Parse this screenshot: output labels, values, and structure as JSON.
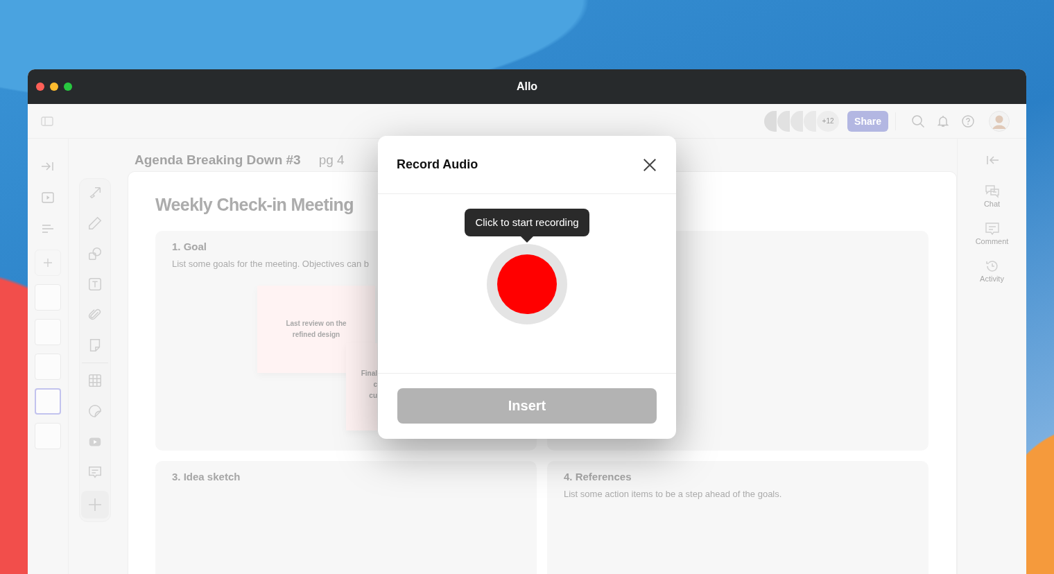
{
  "window": {
    "title": "Allo"
  },
  "toolbar": {
    "more_collaborators": "+12",
    "share_button": "Share"
  },
  "page_thumbnails": [
    {
      "selected": false
    },
    {
      "selected": false
    },
    {
      "selected": false
    },
    {
      "selected": true
    },
    {
      "selected": false
    }
  ],
  "document": {
    "name": "Agenda Breaking Down #3",
    "page": "pg 4",
    "heading": "Weekly Check-in Meeting",
    "sections": [
      {
        "title": "1. Goal",
        "description": "List some goals for the meeting. Objectives can b",
        "notes": [
          {
            "lines": [
              "Last review on the",
              "refined design"
            ]
          },
          {
            "lines": [
              "Final",
              "c",
              "cu"
            ]
          }
        ]
      },
      {
        "title": "3. Idea sketch"
      },
      {
        "title": "4. References",
        "description": "List some action items to be a step ahead of the goals."
      }
    ]
  },
  "right_panel": [
    {
      "kind": "chat",
      "label": "Chat"
    },
    {
      "kind": "comment",
      "label": "Comment"
    },
    {
      "kind": "activity",
      "label": "Activity"
    }
  ],
  "dialog": {
    "title": "Record Audio",
    "tooltip": "Click to start recording",
    "insert_button": {
      "label": "Insert",
      "disabled": true
    }
  }
}
